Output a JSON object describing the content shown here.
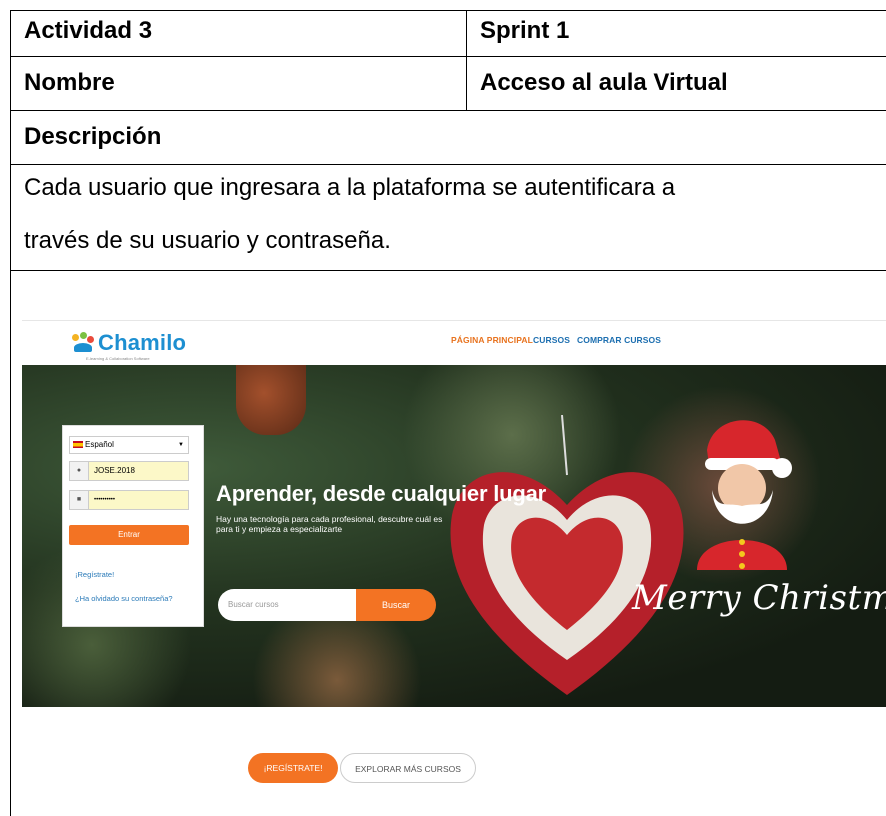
{
  "table": {
    "actividad_label": "Actividad 3",
    "sprint_label": "Sprint 1",
    "nombre_label": "Nombre",
    "nombre_value": "Acceso al aula Virtual",
    "descripcion_label": "Descripción",
    "descripcion_line1": "Cada usuario que ingresara a la plataforma se autentificara a",
    "descripcion_line2": "través de su usuario y contraseña."
  },
  "screenshot": {
    "logo_text": "Chamilo",
    "logo_subtitle": "E-learning & Collaboration Software",
    "nav": [
      "PÁGINA PRINCIPAL",
      "CURSOS",
      "COMPRAR CURSOS"
    ],
    "login": {
      "language": "Español",
      "username_value": "JOSE.2018",
      "password_value": "••••••••••",
      "submit_label": "Entrar",
      "register_link": "¡Regístrate!",
      "forgot_link": "¿Ha olvidado su contraseña?"
    },
    "hero_title": "Aprender, desde cualquier lugar",
    "hero_subtitle": "Hay una tecnología para cada profesional, descubre cuál es para ti y empieza a especializarte",
    "search_placeholder": "Buscar cursos",
    "search_button": "Buscar",
    "merry_text": "Merry Christmas!",
    "cta_register": "¡REGÍSTRATE!",
    "cta_explore": "EXPLORAR MÁS CURSOS"
  },
  "colors": {
    "accent_orange": "#f37323",
    "nav_orange": "#e8731f",
    "nav_blue": "#1d6fb0",
    "logo_blue": "#1d8fd1"
  }
}
